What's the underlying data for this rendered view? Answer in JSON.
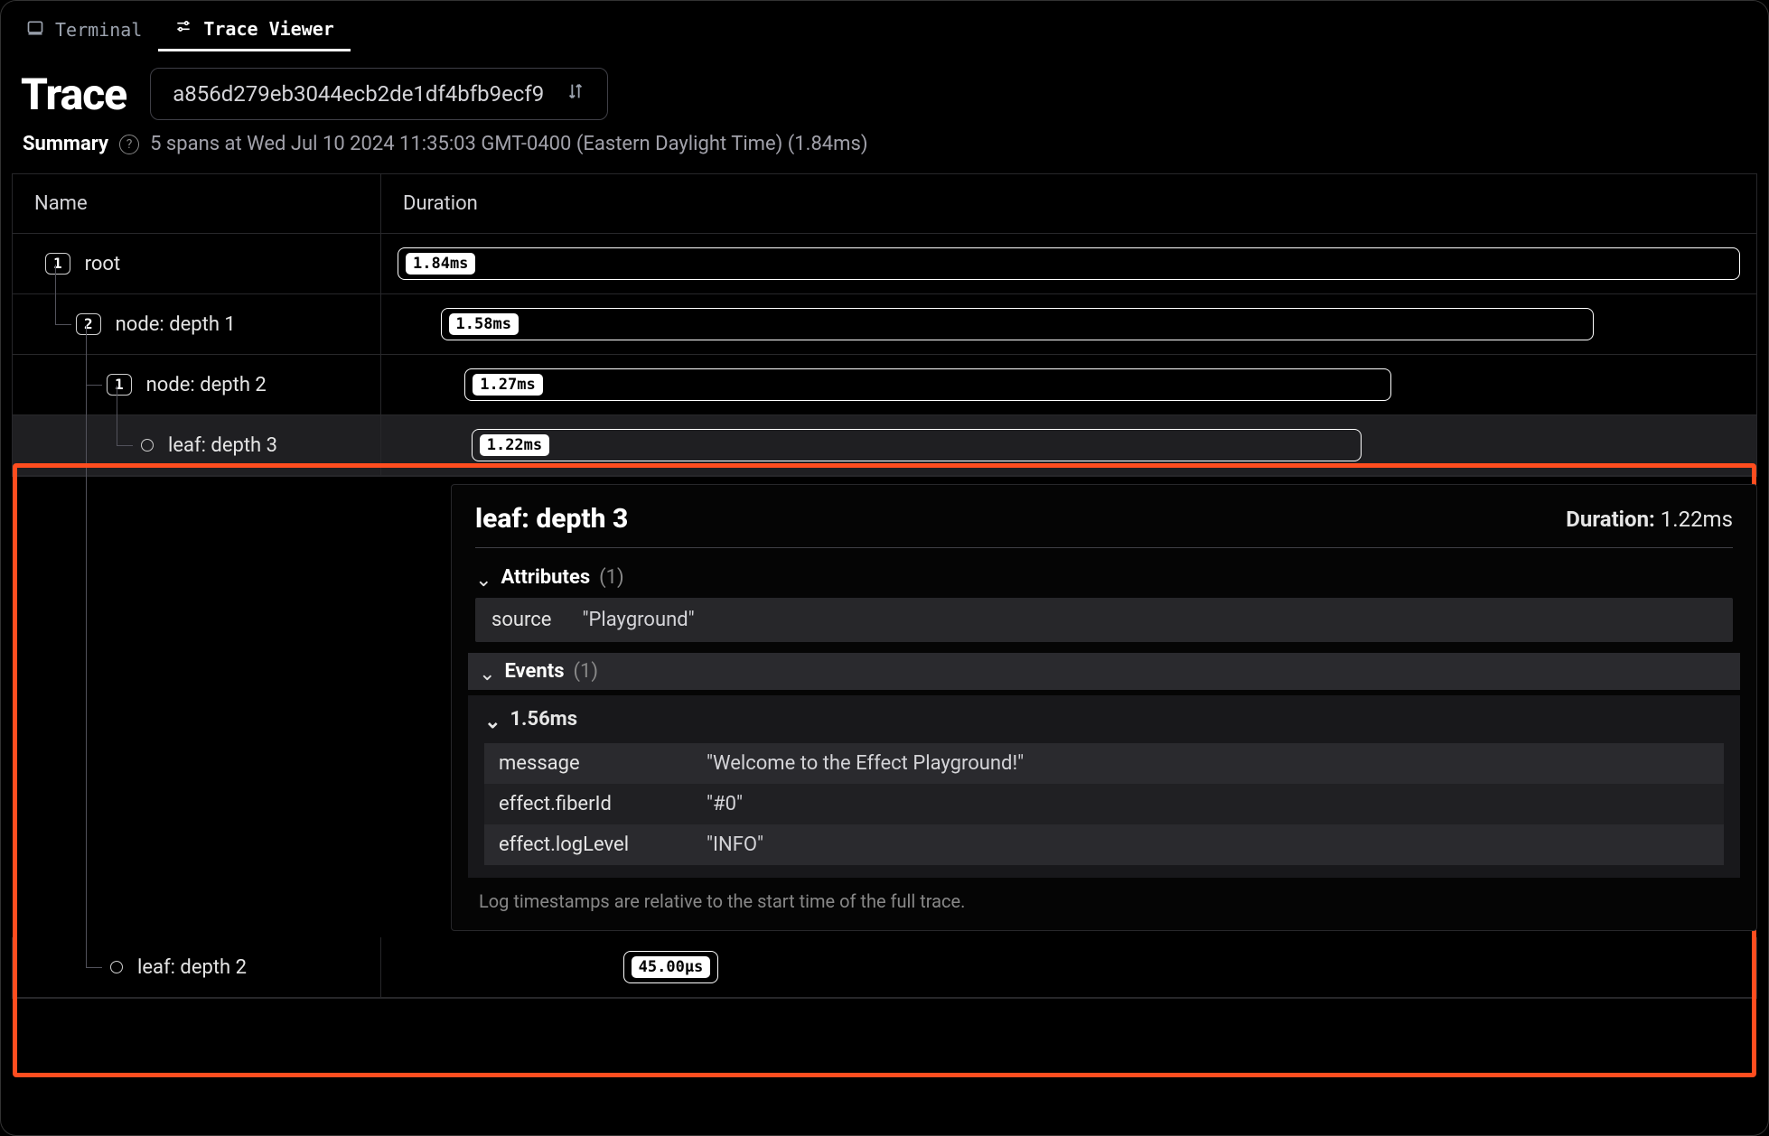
{
  "tabs": {
    "terminal": "Terminal",
    "trace_viewer": "Trace Viewer"
  },
  "header": {
    "title": "Trace",
    "trace_id": "a856d279eb3044ecb2de1df4bfb9ecf9"
  },
  "summary": {
    "label": "Summary",
    "text": "5 spans at Wed Jul 10 2024 11:35:03 GMT-0400 (Eastern Daylight Time) (1.84ms)"
  },
  "columns": {
    "name": "Name",
    "duration": "Duration"
  },
  "spans": [
    {
      "depth": 0,
      "badge": "1",
      "label": "root",
      "duration": "1.84ms",
      "offset_pct": 0,
      "width_pct": 100
    },
    {
      "depth": 1,
      "badge": "2",
      "label": "node: depth 1",
      "duration": "1.58ms",
      "offset_pct": 3.2,
      "width_pct": 85.9
    },
    {
      "depth": 2,
      "badge": "1",
      "label": "node: depth 2",
      "duration": "1.27ms",
      "offset_pct": 5.0,
      "width_pct": 69.0
    },
    {
      "depth": 3,
      "badge": null,
      "label": "leaf: depth 3",
      "duration": "1.22ms",
      "offset_pct": 5.5,
      "width_pct": 66.3
    },
    {
      "depth": 2,
      "badge": null,
      "label": "leaf: depth 2",
      "duration": "45.00µs",
      "offset_pct": 16.8,
      "width_pct": 2.4
    }
  ],
  "details": {
    "title": "leaf: depth 3",
    "duration_label": "Duration:",
    "duration_value": "1.22ms",
    "attributes_label": "Attributes",
    "attributes_count": "(1)",
    "attributes": [
      {
        "key": "source",
        "value": "\"Playground\""
      }
    ],
    "events_label": "Events",
    "events_count": "(1)",
    "events": [
      {
        "time": "1.56ms",
        "rows": [
          {
            "key": "message",
            "value": "\"Welcome to the Effect Playground!\""
          },
          {
            "key": "effect.fiberId",
            "value": "\"#0\""
          },
          {
            "key": "effect.logLevel",
            "value": "\"INFO\""
          }
        ]
      }
    ],
    "footnote": "Log timestamps are relative to the start time of the full trace."
  }
}
